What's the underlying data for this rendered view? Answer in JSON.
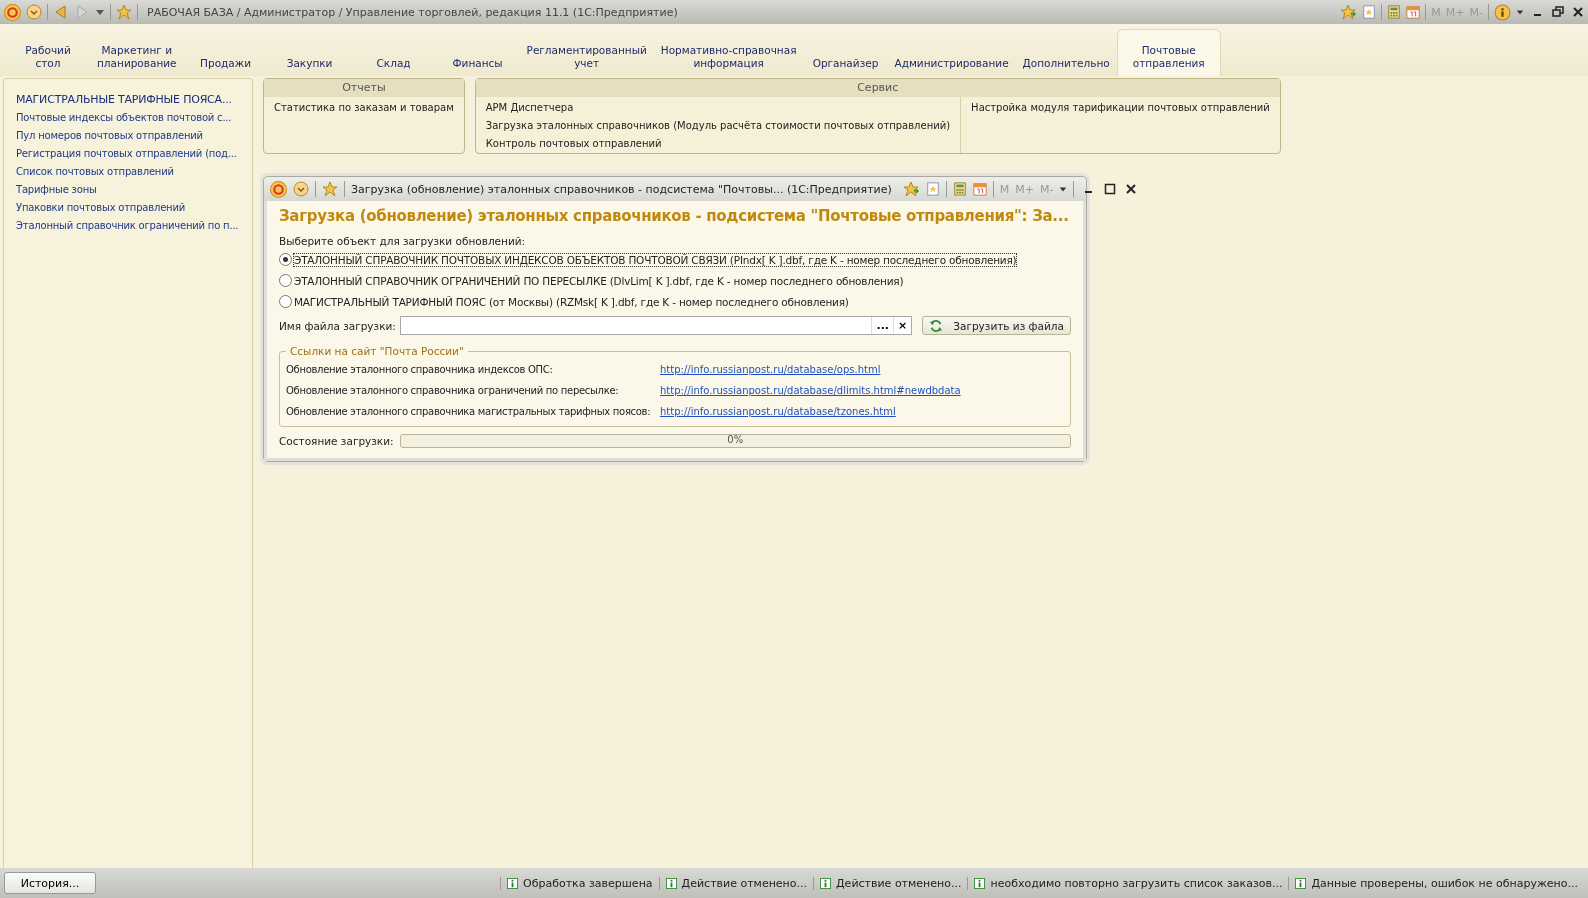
{
  "window": {
    "title": "РАБОЧАЯ БАЗА / Администратор / Управление торговлей, редакция 11.1  (1С:Предприятие)",
    "memory_buttons": [
      {
        "label": "M",
        "disabled": true
      },
      {
        "label": "M+",
        "disabled": true
      },
      {
        "label": "M-",
        "disabled": true
      }
    ]
  },
  "tabs": [
    {
      "label": "Рабочий\nстол",
      "selected": false
    },
    {
      "label": "Маркетинг и\nпланирование",
      "selected": false
    },
    {
      "label": "Продажи",
      "selected": false
    },
    {
      "label": "Закупки",
      "selected": false
    },
    {
      "label": "Склад",
      "selected": false
    },
    {
      "label": "Финансы",
      "selected": false
    },
    {
      "label": "Регламентированный\nучет",
      "selected": false
    },
    {
      "label": "Нормативно-справочная\nинформация",
      "selected": false
    },
    {
      "label": "Органайзер",
      "selected": false
    },
    {
      "label": "Администрирование",
      "selected": false
    },
    {
      "label": "Дополнительно",
      "selected": false
    },
    {
      "label": "Почтовые\nотправления",
      "selected": true
    }
  ],
  "sidebar": {
    "items": [
      "МАГИСТРАЛЬНЫЕ ТАРИФНЫЕ ПОЯСА...",
      "Почтовые индексы объектов почтовой с...",
      "Пул номеров почтовых отправлений",
      "Регистрация почтовых отправлений (под...",
      "Список почтовых отправлений",
      "Тарифные зоны",
      "Упаковки почтовых отправлений",
      "Эталонный справочник ограничений по п..."
    ]
  },
  "command_groups": [
    {
      "title": "Отчеты",
      "columns": [
        [
          "Статистика по заказам и товарам"
        ]
      ]
    },
    {
      "title": "Сервис",
      "columns": [
        [
          "АРМ Диспетчера",
          "Загрузка эталонных справочников (Модуль расчёта стоимости почтовых отправлений)",
          "Контроль почтовых отправлений"
        ],
        [
          "Настройка модуля тарификации почтовых отправлений"
        ]
      ]
    }
  ],
  "dialog": {
    "title": "Загрузка (обновление) эталонных справочников - подсистема \"Почтовы...  (1С:Предприятие)",
    "memory_buttons": [
      {
        "label": "M",
        "disabled": true
      },
      {
        "label": "M+",
        "disabled": true
      },
      {
        "label": "M-",
        "disabled": true
      }
    ],
    "heading": "Загрузка (обновление) эталонных справочников - подсистема \"Почтовые отправления\": За...",
    "choose_label": "Выберите объект для загрузки обновлений:",
    "options": [
      {
        "label": "ЭТАЛОННЫЙ СПРАВОЧНИК ПОЧТОВЫХ ИНДЕКСОВ ОБЪЕКТОВ ПОЧТОВОЙ СВЯЗИ (PIndx[ K ].dbf, где K - номер последнего обновления)",
        "selected": true
      },
      {
        "label": "ЭТАЛОННЫЙ СПРАВОЧНИК ОГРАНИЧЕНИЙ ПО ПЕРЕСЫЛКЕ (DlvLim[ K ].dbf, где K - номер последнего обновления)",
        "selected": false
      },
      {
        "label": "МАГИСТРАЛЬНЫЙ ТАРИФНЫЙ ПОЯС (от Москвы) (RZMsk[ K ].dbf, где K - номер последнего обновления)",
        "selected": false
      }
    ],
    "file_label": "Имя файла загрузки:",
    "browse_button": "...",
    "clear_button": "×",
    "load_button": "Загрузить из файла",
    "links_group": {
      "title": "Ссылки на сайт \"Почта России\"",
      "rows": [
        {
          "label": "Обновление эталонного справочника индексов ОПС:",
          "url": "http://info.russianpost.ru/database/ops.html"
        },
        {
          "label": "Обновление эталонного справочника ограничений по пересылке:",
          "url": "http://info.russianpost.ru/database/dlimits.html#newdbdata"
        },
        {
          "label": "Обновление эталонного справочника магистральных тарифных поясов:",
          "url": "http://info.russianpost.ru/database/tzones.html"
        }
      ]
    },
    "progress_label": "Состояние загрузки:",
    "progress": {
      "level": 0,
      "reading": "0%"
    }
  },
  "status_bar": {
    "history_button": "История...",
    "messages": [
      "Обработка завершена",
      "Действие отменено...",
      "Действие отменено...",
      "необходимо повторно загрузить список заказов...",
      "Данные проверены, ошибок не обнаружено..."
    ]
  }
}
